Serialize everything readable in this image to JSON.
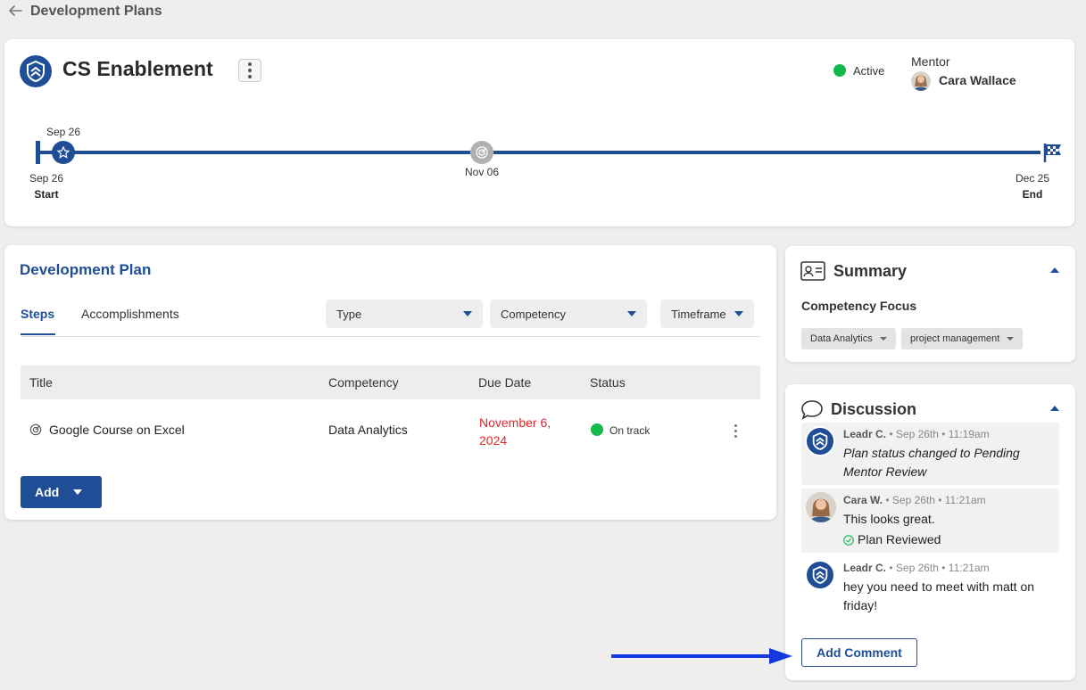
{
  "header": {
    "title": "Development Plans"
  },
  "plan": {
    "title": "CS Enablement",
    "status": "Active",
    "mentor_label": "Mentor",
    "mentor_name": "Cara Wallace",
    "status_color": "#13b94d"
  },
  "timeline": {
    "start_date": "Sep 26",
    "start_label": "Start",
    "milestone_top_date": "Sep 26",
    "mid_date": "Nov 06",
    "end_date": "Dec 25",
    "end_label": "End"
  },
  "dev_plan": {
    "title": "Development Plan",
    "tabs": [
      {
        "label": "Steps",
        "active": true
      },
      {
        "label": "Accomplishments",
        "active": false
      }
    ],
    "filters": [
      "Type",
      "Competency",
      "Timeframe"
    ],
    "columns": [
      "Title",
      "Competency",
      "Due Date",
      "Status"
    ],
    "rows": [
      {
        "title": "Google Course on Excel",
        "competency": "Data Analytics",
        "due_line1": "November 6,",
        "due_line2": "2024",
        "status": "On track",
        "due_color": "#e0262b"
      }
    ],
    "add_label": "Add"
  },
  "summary": {
    "title": "Summary",
    "focus_label": "Competency Focus",
    "chips": [
      "Data Analytics",
      "project management"
    ]
  },
  "discussion": {
    "title": "Discussion",
    "messages": [
      {
        "author": "Leadr C.",
        "time": "Sep 26th • 11:19am",
        "line1": "Plan status changed to Pending",
        "line2": "Mentor Review"
      },
      {
        "author": "Cara W.",
        "time": "Sep 26th • 11:21am",
        "line1": "This looks great.",
        "badge": "Plan Reviewed"
      },
      {
        "author": "Leadr C.",
        "time": "Sep 26th • 11:21am",
        "line1": "hey you need to meet with matt on",
        "line2": "friday!"
      }
    ],
    "add_comment_label": "Add Comment"
  },
  "colors": {
    "accent": "#1f4e96",
    "arrow": "#1238e0"
  }
}
